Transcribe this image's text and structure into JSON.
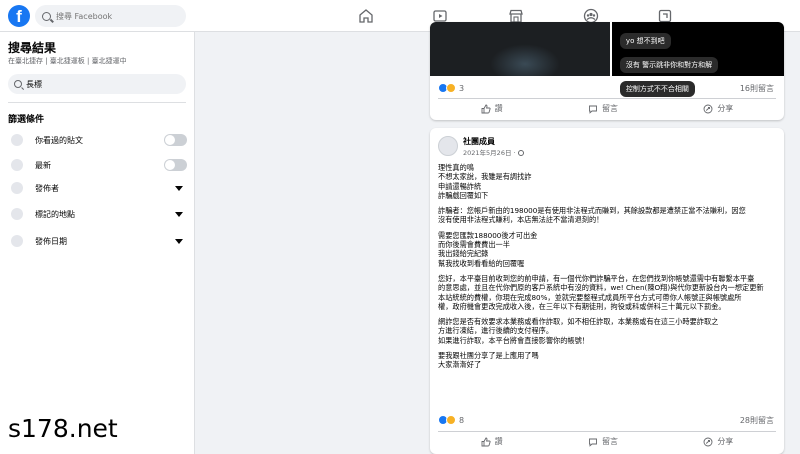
{
  "header": {
    "logo": "f",
    "search_placeholder": "搜尋 Facebook",
    "nav_icons": [
      "home-icon",
      "video-icon",
      "marketplace-icon",
      "groups-icon",
      "gaming-icon"
    ]
  },
  "sidebar": {
    "title": "搜尋結果",
    "breadcrumb": "在臺北捷存 | 臺北捷運板 | 臺北捷運中",
    "search_value": "長標",
    "section_title": "篩選條件",
    "filters": [
      {
        "label": "你看過的貼文",
        "type": "toggle"
      },
      {
        "label": "最新",
        "type": "toggle"
      },
      {
        "label": "發佈者",
        "type": "dropdown"
      },
      {
        "label": "標記的地點",
        "type": "dropdown"
      },
      {
        "label": "發佈日期",
        "type": "dropdown"
      }
    ]
  },
  "post1": {
    "bubbles": [
      "yo 想不到吧",
      "沒有 警示跳非你和對方和解",
      "控制方式不不合相關"
    ],
    "reaction_count": "3",
    "comments": "16則留言",
    "actions": {
      "like": "讚",
      "comment": "留言",
      "share": "分享"
    }
  },
  "post2": {
    "author": "社團成員",
    "time": "2021年5月26日 · ",
    "body": [
      "理性真的鳴",
      "不想太家說，我雖是有調找詐",
      "申請還暢詐統",
      "詐騙戲回覆如下",
      "",
      "詐騙者：您帳戶新由的198000是有使用非法程式而賺到，其餘設款都是遭禁正當不法賺利，因您",
      "沒有使用非法程式賺利，本店無法註不當清退刻的！",
      "",
      "需要您匯款188000後才可出金",
      "而你後需會費費出一半",
      "我出錢給完紀錄",
      "幫我找收到看看給的回覆喔",
      "",
      "您好，本平臺目前收到您的前申請，有一個代你們詐騙平台，在您們找到你帳號還需中有聯繫本平臺",
      "的意思處，並且在代你們原的客戶系統中有沒的資料，we! Chen(陳O翔)與代你更新設台內一想定更新",
      "本站統統的費權，你現在完成80%，並就完要整程式成員所平台方式可帶你人帳號正與帳號處所",
      "權，政府機會更改完成收入後，在三年以下有期徒刑，拘役或科或併科三十萬元以下罰金。",
      "",
      "網詐您是否有效要求本業務或看作詐取，如不相任詐取，本業務或有在這三小時要詐取之",
      "方進行凍結，進行後續的支付程序。",
      "如果進行詐取，本平台將會直接影響你的帳號！",
      "",
      "要我跟社團分享了是上應用了嗎",
      "大家漸漸好了"
    ],
    "reaction_count": "8",
    "comments": "28則留言",
    "actions": {
      "like": "讚",
      "comment": "留言",
      "share": "分享"
    }
  },
  "watermark": "s178.net"
}
